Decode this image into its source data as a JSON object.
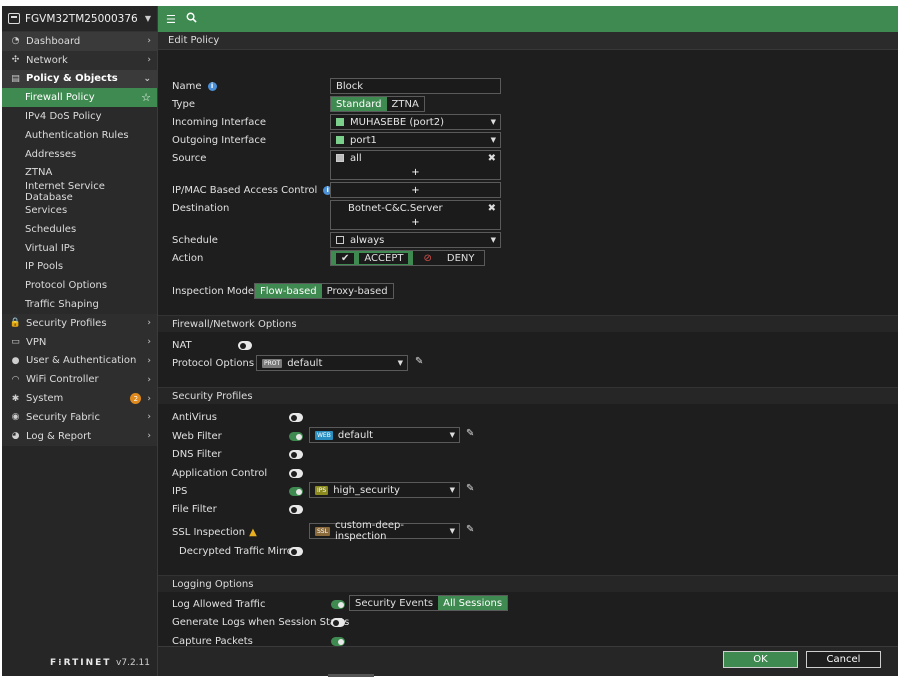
{
  "sidebar": {
    "device_name": "FGVM32TM25000376",
    "items": [
      {
        "label": "Dashboard",
        "icon": "dashboard-icon",
        "kind": "top",
        "chev": "›"
      },
      {
        "label": "Network",
        "icon": "network-icon",
        "kind": "top",
        "chev": "›"
      },
      {
        "label": "Policy & Objects",
        "icon": "policy-icon",
        "kind": "open",
        "chev": "⌄"
      },
      {
        "label": "Firewall Policy",
        "kind": "active"
      },
      {
        "label": "IPv4 DoS Policy",
        "kind": "sub"
      },
      {
        "label": "Authentication Rules",
        "kind": "sub"
      },
      {
        "label": "Addresses",
        "kind": "sub"
      },
      {
        "label": "ZTNA",
        "kind": "sub"
      },
      {
        "label": "Internet Service Database",
        "kind": "sub"
      },
      {
        "label": "Services",
        "kind": "sub"
      },
      {
        "label": "Schedules",
        "kind": "sub"
      },
      {
        "label": "Virtual IPs",
        "kind": "sub"
      },
      {
        "label": "IP Pools",
        "kind": "sub"
      },
      {
        "label": "Protocol Options",
        "kind": "sub"
      },
      {
        "label": "Traffic Shaping",
        "kind": "sub"
      },
      {
        "label": "Security Profiles",
        "icon": "lock-icon",
        "kind": "top",
        "chev": "›"
      },
      {
        "label": "VPN",
        "icon": "monitor-icon",
        "kind": "top",
        "chev": "›"
      },
      {
        "label": "User & Authentication",
        "icon": "user-icon",
        "kind": "top",
        "chev": "›"
      },
      {
        "label": "WiFi Controller",
        "icon": "wifi-icon",
        "kind": "top",
        "chev": "›"
      },
      {
        "label": "System",
        "icon": "gear-icon",
        "kind": "top",
        "chev": "›",
        "badge": "2"
      },
      {
        "label": "Security Fabric",
        "icon": "fabric-icon",
        "kind": "top",
        "chev": "›"
      },
      {
        "label": "Log & Report",
        "icon": "chart-icon",
        "kind": "top",
        "chev": "›"
      }
    ],
    "logo": "F⁝RTINET",
    "version": "v7.2.11"
  },
  "page_title": "Edit Policy",
  "form": {
    "name_label": "Name",
    "name_value": "Block",
    "type_label": "Type",
    "type_options": [
      "Standard",
      "ZTNA"
    ],
    "incoming_label": "Incoming Interface",
    "incoming_value": "MUHASEBE (port2)",
    "outgoing_label": "Outgoing Interface",
    "outgoing_value": "port1",
    "source_label": "Source",
    "source_value": "all",
    "ipmac_label": "IP/MAC Based Access Control",
    "destination_label": "Destination",
    "destination_value": "Botnet-C&C.Server",
    "schedule_label": "Schedule",
    "schedule_value": "always",
    "action_label": "Action",
    "action_accept": "ACCEPT",
    "action_deny": "DENY",
    "inspection_label": "Inspection Mode",
    "inspection_options": [
      "Flow-based",
      "Proxy-based"
    ],
    "add_symbol": "+"
  },
  "fw_section": {
    "title": "Firewall/Network Options",
    "nat_label": "NAT",
    "protocol_label": "Protocol Options",
    "protocol_tag": "PROT",
    "protocol_value": "default"
  },
  "sp_section": {
    "title": "Security Profiles",
    "antivirus": "AntiVirus",
    "webfilter": "Web Filter",
    "webfilter_tag": "WEB",
    "webfilter_value": "default",
    "dnsfilter": "DNS Filter",
    "appcontrol": "Application Control",
    "ips": "IPS",
    "ips_tag": "IPS",
    "ips_value": "high_security",
    "filefilter": "File Filter",
    "ssl": "SSL Inspection",
    "ssl_tag": "SSL",
    "ssl_value": "custom-deep-inspection",
    "decrypted": "Decrypted Traffic Mirror"
  },
  "log_section": {
    "title": "Logging Options",
    "log_allowed": "Log Allowed Traffic",
    "log_options": [
      "Security Events",
      "All Sessions"
    ],
    "gen_logs": "Generate Logs when Session Starts",
    "capture": "Capture Packets"
  },
  "buttons": {
    "ok": "OK",
    "cancel": "Cancel"
  },
  "colors": {
    "accent": "#3e8a50",
    "background": "#1e1e1e",
    "sidebar": "#262626",
    "deny": "#d9534f",
    "warning": "#e8b020",
    "info": "#4b8fd6"
  }
}
